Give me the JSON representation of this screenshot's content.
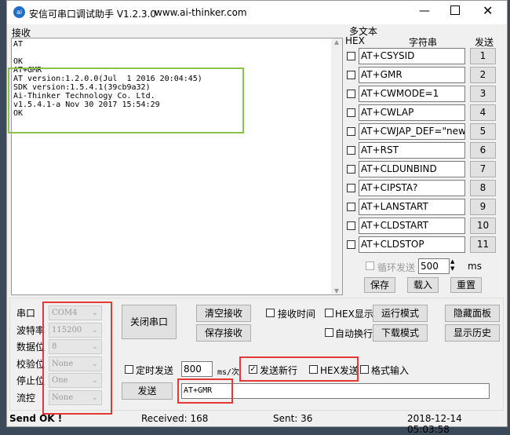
{
  "window": {
    "title": "安信可串口调试助手 V1.2.3.0",
    "url": "www.ai-thinker.com",
    "logo": "ai"
  },
  "receive": {
    "label": "接收",
    "lines": [
      "AT",
      "",
      "OK",
      "AT+GMR",
      "AT version:1.2.0.0(Jul  1 2016 20:04:45)",
      "SDK version:1.5.4.1(39cb9a32)",
      "Ai-Thinker Technology Co. Ltd.",
      "v1.5.4.1-a Nov 30 2017 15:54:29",
      "OK"
    ]
  },
  "multi": {
    "label": "多文本",
    "hex_header": "HEX",
    "string_header": "字符串",
    "send_header": "发送",
    "rows": [
      {
        "text": "AT+CSYSID",
        "n": "1"
      },
      {
        "text": "AT+GMR",
        "n": "2"
      },
      {
        "text": "AT+CWMODE=1",
        "n": "3"
      },
      {
        "text": "AT+CWLAP",
        "n": "4"
      },
      {
        "text": "AT+CWJAP_DEF=\"newifi_",
        "n": "5"
      },
      {
        "text": "AT+RST",
        "n": "6"
      },
      {
        "text": "AT+CLDUNBIND",
        "n": "7"
      },
      {
        "text": "AT+CIPSTA?",
        "n": "8"
      },
      {
        "text": "AT+LANSTART",
        "n": "9"
      },
      {
        "text": "AT+CLDSTART",
        "n": "10"
      },
      {
        "text": "AT+CLDSTOP",
        "n": "11"
      }
    ],
    "loop_label": "循环发送",
    "loop_value": "500",
    "ms": "ms",
    "save": "保存",
    "load": "载入",
    "reset": "重置"
  },
  "serial": {
    "port_label": "串口",
    "port": "COM4",
    "baud_label": "波特率",
    "baud": "115200",
    "data_label": "数据位",
    "data": "8",
    "parity_label": "校验位",
    "parity": "None",
    "stop_label": "停止位",
    "stop": "One",
    "flow_label": "流控",
    "flow": "None"
  },
  "controls": {
    "close_port": "关闭串口",
    "clear_recv": "清空接收",
    "save_recv": "保存接收",
    "recv_time": "接收时间",
    "hex_show": "HEX显示",
    "auto_wrap": "自动换行",
    "run_mode": "运行模式",
    "download_mode": "下载模式",
    "hide_panel": "隐藏面板",
    "show_history": "显示历史"
  },
  "send": {
    "timed": "定时发送",
    "interval": "800",
    "unit": "ms/次",
    "newline": "发送新行",
    "newline_checked": true,
    "hex_send": "HEX发送",
    "format_input": "格式输入",
    "send_btn": "发送",
    "input": "AT+GMR"
  },
  "status": {
    "msg": "Send OK !",
    "received": "Received: 168",
    "sent": "Sent: 36",
    "time": "2018-12-14 05:03:58"
  }
}
